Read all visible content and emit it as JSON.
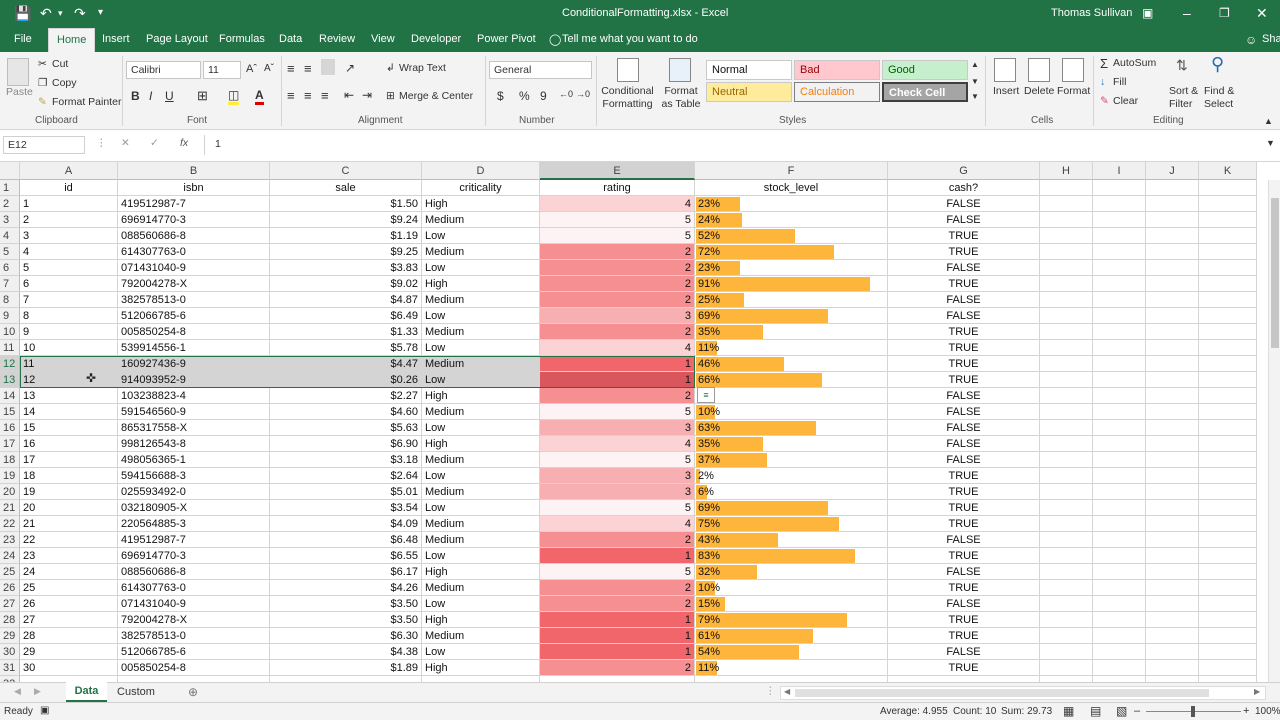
{
  "titlebar": {
    "filename_title": "ConditionalFormatting.xlsx - Excel",
    "user": "Thomas Sullivan"
  },
  "tabs": [
    "File",
    "Home",
    "Insert",
    "Page Layout",
    "Formulas",
    "Data",
    "Review",
    "View",
    "Developer",
    "Power Pivot"
  ],
  "tell_me": "Tell me what you want to do",
  "share": "Share",
  "ribbon": {
    "clipboard": {
      "paste": "Paste",
      "cut": "Cut",
      "copy": "Copy",
      "format_painter": "Format Painter",
      "label": "Clipboard"
    },
    "font": {
      "name": "Calibri",
      "size": "11",
      "label": "Font",
      "bold": "B",
      "italic": "I",
      "underline": "U"
    },
    "alignment": {
      "wrap_text": "Wrap Text",
      "merge_center": "Merge & Center",
      "label": "Alignment"
    },
    "number": {
      "format": "General",
      "currency": "$",
      "percent": "%",
      "comma": "9",
      "label": "Number"
    },
    "styles": {
      "conditional_formatting": "Conditional Formatting",
      "format_as_table": "Format as Table",
      "normal": "Normal",
      "bad": "Bad",
      "good": "Good",
      "neutral": "Neutral",
      "calculation": "Calculation",
      "check_cell": "Check Cell",
      "label": "Styles"
    },
    "cells": {
      "insert": "Insert",
      "delete": "Delete",
      "format": "Format",
      "label": "Cells"
    },
    "editing": {
      "autosum": "AutoSum",
      "fill": "Fill",
      "clear": "Clear",
      "sort_filter": "Sort & Filter",
      "find_select": "Find & Select",
      "label": "Editing"
    }
  },
  "formula_bar": {
    "name_box": "E12",
    "fx": "fx",
    "formula": "1"
  },
  "columns": [
    "A",
    "B",
    "C",
    "D",
    "E",
    "F",
    "G",
    "H",
    "I",
    "J",
    "K"
  ],
  "headers": {
    "id": "id",
    "isbn": "isbn",
    "sale": "sale",
    "criticality": "criticality",
    "rating": "rating",
    "stock_level": "stock_level",
    "cash": "cash?"
  },
  "rows": [
    {
      "id": "1",
      "isbn": "419512987-7",
      "sale": "$1.50",
      "criticality": "High",
      "rating": 4,
      "stock": 23,
      "cash": "FALSE"
    },
    {
      "id": "2",
      "isbn": "696914770-3",
      "sale": "$9.24",
      "criticality": "Medium",
      "rating": 5,
      "stock": 24,
      "cash": "FALSE"
    },
    {
      "id": "3",
      "isbn": "088560686-8",
      "sale": "$1.19",
      "criticality": "Low",
      "rating": 5,
      "stock": 52,
      "cash": "TRUE"
    },
    {
      "id": "4",
      "isbn": "614307763-0",
      "sale": "$9.25",
      "criticality": "Medium",
      "rating": 2,
      "stock": 72,
      "cash": "TRUE"
    },
    {
      "id": "5",
      "isbn": "071431040-9",
      "sale": "$3.83",
      "criticality": "Low",
      "rating": 2,
      "stock": 23,
      "cash": "FALSE"
    },
    {
      "id": "6",
      "isbn": "792004278-X",
      "sale": "$9.02",
      "criticality": "High",
      "rating": 2,
      "stock": 91,
      "cash": "TRUE"
    },
    {
      "id": "7",
      "isbn": "382578513-0",
      "sale": "$4.87",
      "criticality": "Medium",
      "rating": 2,
      "stock": 25,
      "cash": "FALSE"
    },
    {
      "id": "8",
      "isbn": "512066785-6",
      "sale": "$6.49",
      "criticality": "Low",
      "rating": 3,
      "stock": 69,
      "cash": "FALSE"
    },
    {
      "id": "9",
      "isbn": "005850254-8",
      "sale": "$1.33",
      "criticality": "Medium",
      "rating": 2,
      "stock": 35,
      "cash": "TRUE"
    },
    {
      "id": "10",
      "isbn": "539914556-1",
      "sale": "$5.78",
      "criticality": "Low",
      "rating": 4,
      "stock": 11,
      "cash": "TRUE"
    },
    {
      "id": "11",
      "isbn": "160927436-9",
      "sale": "$4.47",
      "criticality": "Medium",
      "rating": 1,
      "stock": 46,
      "cash": "TRUE"
    },
    {
      "id": "12",
      "isbn": "914093952-9",
      "sale": "$0.26",
      "criticality": "Low",
      "rating": 1,
      "stock": 66,
      "cash": "TRUE"
    },
    {
      "id": "13",
      "isbn": "103238823-4",
      "sale": "$2.27",
      "criticality": "High",
      "rating": 2,
      "stock": 0,
      "cash": "FALSE"
    },
    {
      "id": "14",
      "isbn": "591546560-9",
      "sale": "$4.60",
      "criticality": "Medium",
      "rating": 5,
      "stock": 10,
      "cash": "FALSE"
    },
    {
      "id": "15",
      "isbn": "865317558-X",
      "sale": "$5.63",
      "criticality": "Low",
      "rating": 3,
      "stock": 63,
      "cash": "FALSE"
    },
    {
      "id": "16",
      "isbn": "998126543-8",
      "sale": "$6.90",
      "criticality": "High",
      "rating": 4,
      "stock": 35,
      "cash": "FALSE"
    },
    {
      "id": "17",
      "isbn": "498056365-1",
      "sale": "$3.18",
      "criticality": "Medium",
      "rating": 5,
      "stock": 37,
      "cash": "FALSE"
    },
    {
      "id": "18",
      "isbn": "594156688-3",
      "sale": "$2.64",
      "criticality": "Low",
      "rating": 3,
      "stock": 2,
      "cash": "TRUE"
    },
    {
      "id": "19",
      "isbn": "025593492-0",
      "sale": "$5.01",
      "criticality": "Medium",
      "rating": 3,
      "stock": 6,
      "cash": "TRUE"
    },
    {
      "id": "20",
      "isbn": "032180905-X",
      "sale": "$3.54",
      "criticality": "Low",
      "rating": 5,
      "stock": 69,
      "cash": "TRUE"
    },
    {
      "id": "21",
      "isbn": "220564885-3",
      "sale": "$4.09",
      "criticality": "Medium",
      "rating": 4,
      "stock": 75,
      "cash": "TRUE"
    },
    {
      "id": "22",
      "isbn": "419512987-7",
      "sale": "$6.48",
      "criticality": "Medium",
      "rating": 2,
      "stock": 43,
      "cash": "FALSE"
    },
    {
      "id": "23",
      "isbn": "696914770-3",
      "sale": "$6.55",
      "criticality": "Low",
      "rating": 1,
      "stock": 83,
      "cash": "TRUE"
    },
    {
      "id": "24",
      "isbn": "088560686-8",
      "sale": "$6.17",
      "criticality": "High",
      "rating": 5,
      "stock": 32,
      "cash": "FALSE"
    },
    {
      "id": "25",
      "isbn": "614307763-0",
      "sale": "$4.26",
      "criticality": "Medium",
      "rating": 2,
      "stock": 10,
      "cash": "TRUE"
    },
    {
      "id": "26",
      "isbn": "071431040-9",
      "sale": "$3.50",
      "criticality": "Low",
      "rating": 2,
      "stock": 15,
      "cash": "FALSE"
    },
    {
      "id": "27",
      "isbn": "792004278-X",
      "sale": "$3.50",
      "criticality": "High",
      "rating": 1,
      "stock": 79,
      "cash": "TRUE"
    },
    {
      "id": "28",
      "isbn": "382578513-0",
      "sale": "$6.30",
      "criticality": "Medium",
      "rating": 1,
      "stock": 61,
      "cash": "TRUE"
    },
    {
      "id": "29",
      "isbn": "512066785-6",
      "sale": "$4.38",
      "criticality": "Low",
      "rating": 1,
      "stock": 54,
      "cash": "FALSE"
    },
    {
      "id": "30",
      "isbn": "005850254-8",
      "sale": "$1.89",
      "criticality": "High",
      "rating": 2,
      "stock": 11,
      "cash": "TRUE"
    }
  ],
  "rating_colors": {
    "1": "#f0666a",
    "2": "#f58f91",
    "3": "#f8afb1",
    "4": "#fbd3d5",
    "5": "#fdf3f4"
  },
  "selected_rating_color": "#d9575c",
  "bar_color": "#fdb53b",
  "sheet_tabs": [
    "Data",
    "Custom"
  ],
  "status": {
    "ready": "Ready",
    "average": "Average: 4.955",
    "count": "Count: 10",
    "sum": "Sum: 29.73",
    "zoom": "100%"
  }
}
